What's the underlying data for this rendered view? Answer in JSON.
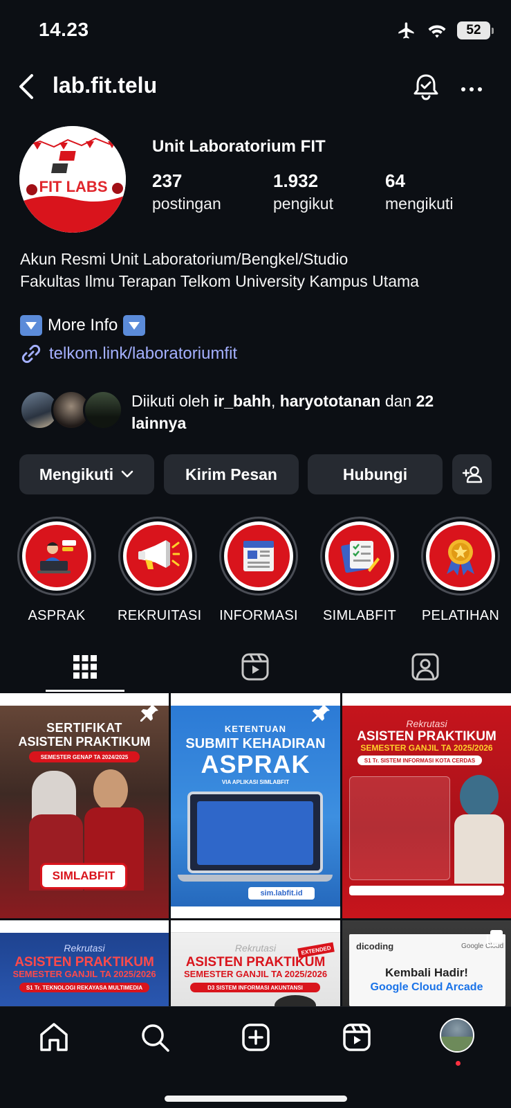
{
  "status_bar": {
    "time": "14.23",
    "battery": "52"
  },
  "header": {
    "username": "lab.fit.telu"
  },
  "profile": {
    "display_name": "Unit Laboratorium FIT",
    "avatar_text": "FIT LABS",
    "stats": [
      {
        "value": "237",
        "label": "postingan"
      },
      {
        "value": "1.932",
        "label": "pengikut"
      },
      {
        "value": "64",
        "label": "mengikuti"
      }
    ],
    "bio_line1": "Akun Resmi Unit Laboratorium/Bengkel/Studio",
    "bio_line2": "Fakultas Ilmu Terapan Telkom University Kampus Utama",
    "more_info": "More Info",
    "link": "telkom.link/laboratoriumfit"
  },
  "followed_by": {
    "prefix": "Diikuti oleh ",
    "user1": "ir_bahh",
    "sep": ", ",
    "user2": "haryototanan",
    "mid": " dan ",
    "count": "22",
    "suffix": "lainnya"
  },
  "buttons": {
    "following": "Mengikuti",
    "message": "Kirim Pesan",
    "contact": "Hubungi"
  },
  "highlights": [
    {
      "label": "ASPRAK"
    },
    {
      "label": "REKRUITASI"
    },
    {
      "label": "INFORMASI"
    },
    {
      "label": "SIMLABFIT"
    },
    {
      "label": "PELATIHAN"
    }
  ],
  "posts": [
    {
      "line1": "SERTIFIKAT",
      "line2": "ASISTEN PRAKTIKUM",
      "line3": "SEMESTER GENAP TA 2024/2025",
      "cta": "SIMLABFIT"
    },
    {
      "line1": "KETENTUAN",
      "line2": "SUBMIT KEHADIRAN",
      "line3": "ASPRAK",
      "sub": "VIA APLIKASI SIMLABFIT",
      "cta": "sim.labfit.id"
    },
    {
      "line1": "Rekrutasi",
      "line2": "ASISTEN PRAKTIKUM",
      "line3": "SEMESTER GANJIL TA 2025/2026",
      "sub": "S1 Tr. SISTEM INFORMASI KOTA CERDAS"
    },
    {
      "line1": "Rekrutasi",
      "line2": "ASISTEN PRAKTIKUM",
      "line3": "SEMESTER GANJIL TA 2025/2026",
      "sub": "S1 Tr. TEKNOLOGI REKAYASA MULTIMEDIA"
    },
    {
      "line1": "Rekrutasi",
      "line2": "ASISTEN PRAKTIKUM",
      "line3": "SEMESTER GANJIL TA 2025/2026",
      "sub": "D3 SISTEM INFORMASI AKUNTANSI",
      "badge": "EXTENDED"
    },
    {
      "line1": "Kembali Hadir!",
      "line2": "Google Cloud Arcade",
      "brand1": "dicoding",
      "brand2": "Google Cloud"
    }
  ],
  "colors": {
    "accent_red": "#d9141c",
    "link_blue": "#a4b0ff",
    "background": "#0c0f14",
    "button_bg": "#262a31"
  }
}
